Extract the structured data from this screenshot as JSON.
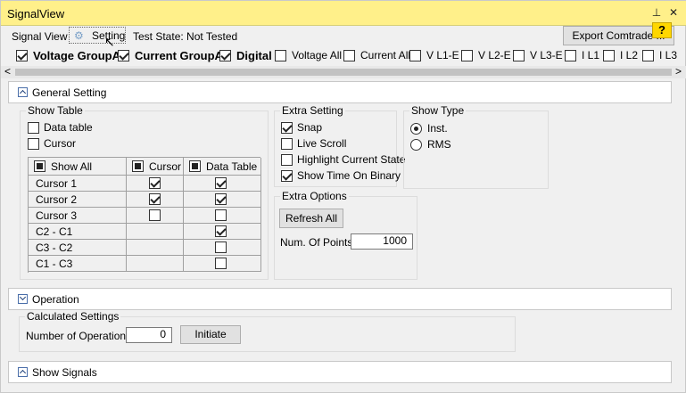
{
  "window": {
    "title": "SignalView"
  },
  "toolbar": {
    "tab_signal_view": "Signal View",
    "tab_setting": "Setting",
    "test_state": "Test State: Not Tested",
    "export_button": "Export Comtrade ...",
    "help_label": "?"
  },
  "signals": [
    {
      "label": "Voltage GroupA",
      "checked": true,
      "bold": true
    },
    {
      "label": "Current GroupA",
      "checked": true,
      "bold": true
    },
    {
      "label": "Digital",
      "checked": true,
      "bold": true
    },
    {
      "label": "Voltage All",
      "checked": false,
      "bold": false
    },
    {
      "label": "Current All",
      "checked": false,
      "bold": false
    },
    {
      "label": "V L1-E",
      "checked": false,
      "bold": false
    },
    {
      "label": "V L2-E",
      "checked": false,
      "bold": false
    },
    {
      "label": "V L3-E",
      "checked": false,
      "bold": false
    },
    {
      "label": "I L1",
      "checked": false,
      "bold": false
    },
    {
      "label": "I L2",
      "checked": false,
      "bold": false
    },
    {
      "label": "I L3",
      "checked": false,
      "bold": false
    }
  ],
  "scrollbar": {
    "left_arrow": "<",
    "right_arrow": ">"
  },
  "general": {
    "header": "General Setting",
    "show_table": {
      "title": "Show Table",
      "data_table": "Data table",
      "cursor": "Cursor",
      "columns": [
        "Show All",
        "Cursor",
        "Data Table"
      ],
      "rows": [
        {
          "name": "Cursor 1",
          "cursor": true,
          "data": true
        },
        {
          "name": "Cursor 2",
          "cursor": true,
          "data": true
        },
        {
          "name": "Cursor 3",
          "cursor": false,
          "data": false
        },
        {
          "name": "C2 - C1",
          "cursor": null,
          "data": true
        },
        {
          "name": "C3 - C2",
          "cursor": null,
          "data": false
        },
        {
          "name": "C1 - C3",
          "cursor": null,
          "data": false
        }
      ]
    },
    "extra_setting": {
      "title": "Extra Setting",
      "items": [
        {
          "label": "Snap",
          "checked": true
        },
        {
          "label": "Live Scroll",
          "checked": false
        },
        {
          "label": "Highlight Current State",
          "checked": false
        },
        {
          "label": "Show Time On Binary",
          "checked": true
        }
      ]
    },
    "extra_options": {
      "title": "Extra Options",
      "refresh_button": "Refresh All",
      "num_points_label": "Num. Of Points",
      "num_points_value": "1000"
    },
    "show_type": {
      "title": "Show Type",
      "options": [
        {
          "label": "Inst.",
          "selected": true
        },
        {
          "label": "RMS",
          "selected": false
        }
      ]
    }
  },
  "operation": {
    "header": "Operation",
    "calculated_title": "Calculated Settings",
    "num_operation_label": "Number of Operation :",
    "num_operation_value": "0",
    "initiate_button": "Initiate"
  },
  "show_signals": {
    "header": "Show Signals"
  }
}
